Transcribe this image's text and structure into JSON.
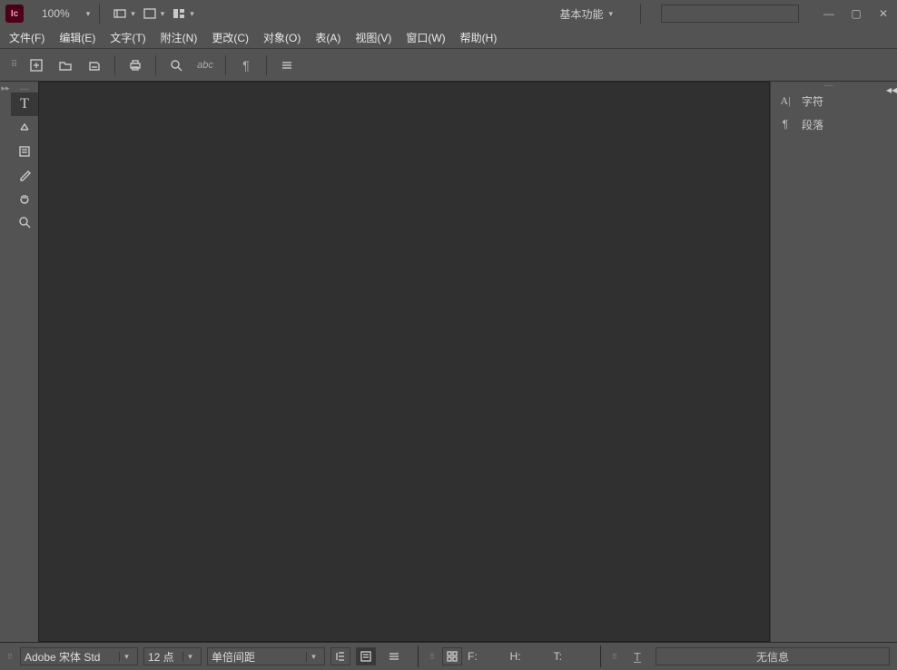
{
  "app": {
    "icon_label": "Ic",
    "zoom": "100%"
  },
  "workspace": {
    "label": "基本功能"
  },
  "menu": {
    "file": "文件(F)",
    "edit": "编辑(E)",
    "type": "文字(T)",
    "notes": "附注(N)",
    "changes": "更改(C)",
    "object": "对象(O)",
    "table": "表(A)",
    "view": "视图(V)",
    "window": "窗口(W)",
    "help": "帮助(H)"
  },
  "panels": {
    "character": "字符",
    "paragraph": "段落"
  },
  "bottom": {
    "font": "Adobe 宋体 Std",
    "size": "12 点",
    "leading": "单倍间距",
    "f_label": "F:",
    "h_label": "H:",
    "t_label": "T:",
    "info": "无信息"
  }
}
